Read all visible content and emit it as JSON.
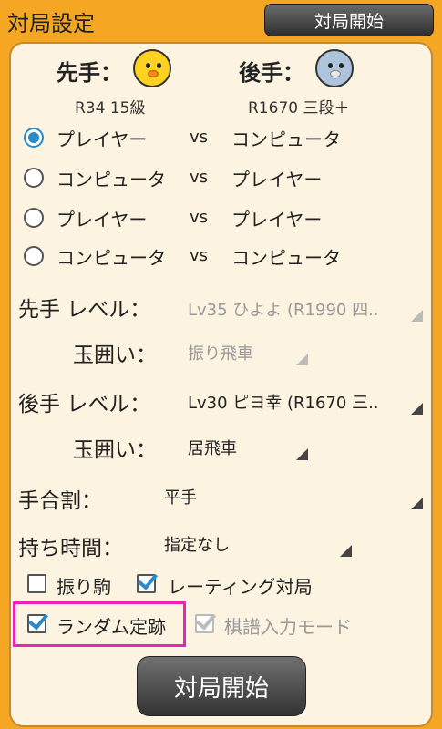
{
  "header": {
    "title": "対局設定",
    "start_button": "対局開始"
  },
  "players": {
    "first_label": "先手：",
    "second_label": "後手：",
    "first_rating": "R34 15級",
    "second_rating": "R1670 三段＋"
  },
  "matchups": [
    {
      "left": "プレイヤー",
      "vs": "vs",
      "right": "コンピュータ",
      "selected": true
    },
    {
      "left": "コンピュータ",
      "vs": "vs",
      "right": "プレイヤー",
      "selected": false
    },
    {
      "left": "プレイヤー",
      "vs": "vs",
      "right": "プレイヤー",
      "selected": false
    },
    {
      "left": "コンピュータ",
      "vs": "vs",
      "right": "コンピュータ",
      "selected": false
    }
  ],
  "form": {
    "first_level_label": "先手 レベル：",
    "first_level_value": "Lv35 ひよよ (R1990 四..",
    "first_castle_label": "玉囲い：",
    "first_castle_value": "振り飛車",
    "second_level_label": "後手 レベル：",
    "second_level_value": "Lv30 ピヨ幸 (R1670 三..",
    "second_castle_label": "玉囲い：",
    "second_castle_value": "居飛車",
    "handicap_label": "手合割：",
    "handicap_value": "平手",
    "time_label": "持ち時間：",
    "time_value": "指定なし"
  },
  "options": {
    "furigoma": {
      "label": "振り駒",
      "checked": false
    },
    "rating_game": {
      "label": "レーティング対局",
      "checked": true
    },
    "random_joseki": {
      "label": "ランダム定跡",
      "checked": true
    },
    "kifu_input": {
      "label": "棋譜入力モード",
      "checked": true,
      "disabled": true
    }
  },
  "start_button": "対局開始",
  "colors": {
    "background": "#f5a623",
    "panel": "#fdf3e1",
    "accent": "#2a8ac8",
    "highlight": "#ee22bb"
  }
}
